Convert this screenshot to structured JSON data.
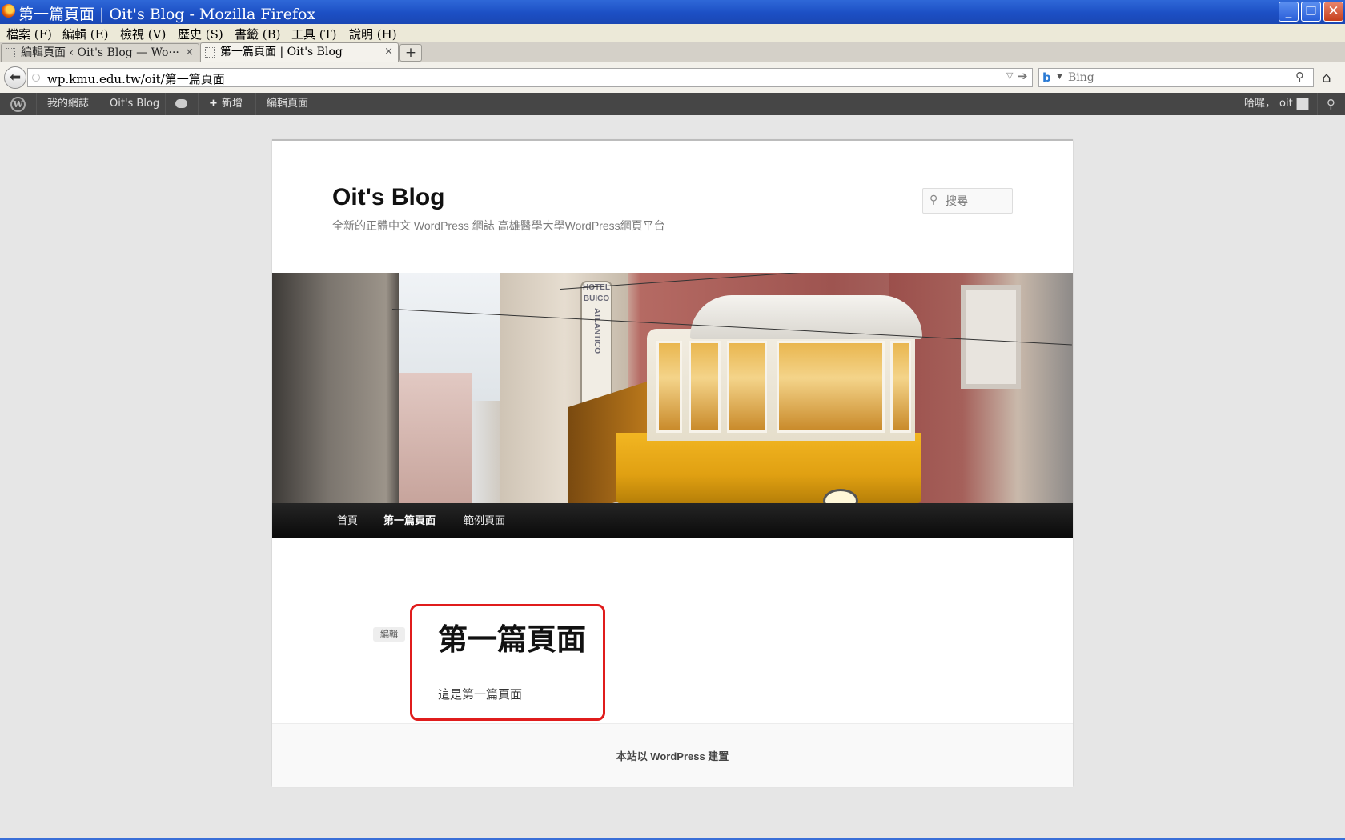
{
  "window": {
    "title": "第一篇頁面 | Oit's Blog - Mozilla Firefox",
    "minimize_glyph": "_",
    "maximize_glyph": "❐",
    "close_glyph": "✕"
  },
  "menubar": {
    "items": [
      "檔案 (F)",
      "編輯 (E)",
      "檢視 (V)",
      "歷史 (S)",
      "書籤 (B)",
      "工具 (T)",
      "說明 (H)"
    ]
  },
  "tabs": [
    {
      "label": "編輯頁面 ‹ Oit's Blog — Wo···",
      "active": false,
      "close": "×"
    },
    {
      "label": "第一篇頁面 | Oit's Blog",
      "active": true,
      "close": "×"
    }
  ],
  "new_tab_label": "+",
  "navbar": {
    "url": "wp.kmu.edu.tw/oit/第一篇頁面",
    "search_placeholder": "Bing",
    "search_engine": "Bing",
    "icons": [
      "back-arrow-icon",
      "site-identity-icon",
      "dropdown-icon",
      "go-arrow-icon",
      "bing-icon",
      "magnifier-icon",
      "home-icon"
    ]
  },
  "adminbar": {
    "my_sites": "我的網誌",
    "site_name": "Oit's Blog",
    "new_label": "新增",
    "new_plus": "+",
    "edit_page": "編輯頁面",
    "greeting": "哈囉，",
    "username": "oit",
    "icons": [
      "wordpress-logo-icon",
      "comment-bubble-icon",
      "avatar-icon",
      "search-icon"
    ]
  },
  "site": {
    "title": "Oit's Blog",
    "description": "全新的正體中文 WordPress 網誌 高雄醫學大學WordPress網頁平台",
    "search_placeholder": "搜尋",
    "banner_sign": [
      "HOTEL",
      "BUICO",
      "ATLANTICO"
    ],
    "nav": [
      {
        "label": "首頁",
        "current": false
      },
      {
        "label": "第一篇頁面",
        "current": true
      },
      {
        "label": "範例頁面",
        "current": false
      }
    ]
  },
  "entry": {
    "edit_label": "編輯",
    "title": "第一篇頁面",
    "content": "這是第一篇頁面"
  },
  "footer": {
    "credit": "本站以 WordPress 建置"
  },
  "colors": {
    "titlebar": "#1c4fc4",
    "adminbar": "#464646",
    "nav_bg": "#111111",
    "highlight_box": "#e01c1c",
    "page_bg": "#e6e6e6"
  }
}
